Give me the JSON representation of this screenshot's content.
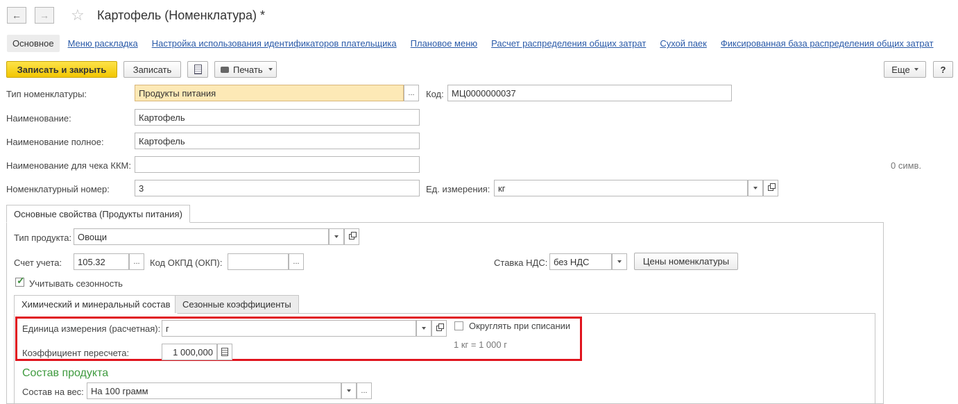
{
  "window": {
    "title": "Картофель (Номенклатура) *"
  },
  "tabs": [
    "Основное",
    "Меню раскладка",
    "Настройка использования идентификаторов плательщика",
    "Плановое меню",
    "Расчет распределения общих затрат",
    "Сухой паек",
    "Фиксированная база распределения общих затрат"
  ],
  "toolbar": {
    "save_close": "Записать и закрыть",
    "save": "Записать",
    "print": "Печать",
    "more": "Еще",
    "help": "?"
  },
  "form": {
    "type_label": "Тип номенклатуры:",
    "type_value": "Продукты питания",
    "code_label": "Код:",
    "code_value": "МЦ0000000037",
    "name_label": "Наименование:",
    "name_value": "Картофель",
    "fullname_label": "Наименование полное:",
    "fullname_value": "Картофель",
    "kkm_label": "Наименование для чека ККМ:",
    "kkm_value": "",
    "chars_count": "0 симв.",
    "number_label": "Номенклатурный номер:",
    "number_value": "3",
    "unit_label": "Ед. измерения:",
    "unit_value": "кг"
  },
  "main_tab": "Основные свойства (Продукты питания)",
  "props": {
    "product_type_label": "Тип продукта:",
    "product_type_value": "Овощи",
    "account_label": "Счет учета:",
    "account_value": "105.32",
    "okpd_label": "Код ОКПД (ОКП):",
    "okpd_value": "",
    "vat_label": "Ставка НДС:",
    "vat_value": "без НДС",
    "prices_button": "Цены номенклатуры",
    "seasonality_label": "Учитывать сезонность",
    "seasonality_checked": true
  },
  "inner_tabs": [
    "Химический и минеральный состав",
    "Сезонные коэффициенты"
  ],
  "chem": {
    "calc_unit_label": "Единица измерения (расчетная):",
    "calc_unit_value": "г",
    "round_label": "Округлять при списании",
    "round_checked": false,
    "ratio_label": "Коэффициент пересчета:",
    "ratio_value": "1 000,000",
    "conversion_text": "1 кг = 1 000 г",
    "section_title": "Состав продукта",
    "weight_label": "Состав на вес:",
    "weight_value": "На 100 грамм"
  },
  "colors": {
    "accent_yellow": "#f2c600",
    "link": "#2a5aa8",
    "highlight_red": "#e0141e",
    "section_green": "#3e9a3e"
  }
}
